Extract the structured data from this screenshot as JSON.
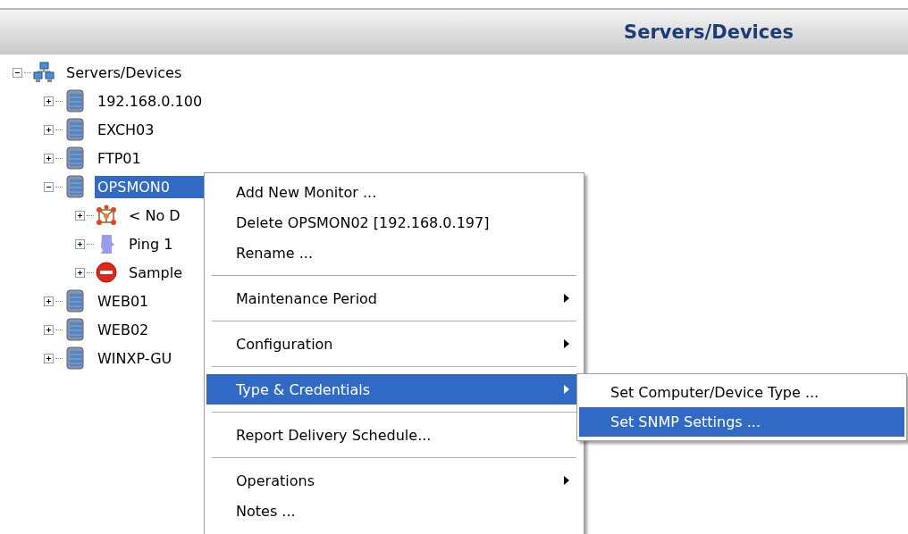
{
  "header": {
    "title": "Servers/Devices"
  },
  "tree": [
    {
      "label": "Servers/Devices",
      "kind": "network",
      "expanded": true,
      "selected": false,
      "children": [
        {
          "label": "192.168.0.100",
          "kind": "server",
          "expanded": false,
          "selected": false
        },
        {
          "label": "EXCH03",
          "kind": "server",
          "expanded": false,
          "selected": false
        },
        {
          "label": "FTP01",
          "kind": "server",
          "expanded": false,
          "selected": false
        },
        {
          "label": "OPSMON0",
          "kind": "server",
          "expanded": true,
          "selected": true,
          "children": [
            {
              "label": "< No D",
              "kind": "cluster",
              "expanded": false,
              "selected": false
            },
            {
              "label": "Ping 1",
              "kind": "probe",
              "expanded": false,
              "selected": false
            },
            {
              "label": "Sample",
              "kind": "stop",
              "expanded": false,
              "selected": false
            }
          ]
        },
        {
          "label": "WEB01",
          "kind": "server",
          "expanded": false,
          "selected": false
        },
        {
          "label": "WEB02",
          "kind": "server",
          "expanded": false,
          "selected": false
        },
        {
          "label": "WINXP-GU",
          "kind": "server",
          "expanded": false,
          "selected": false
        }
      ]
    }
  ],
  "context_menu": {
    "sections": [
      [
        {
          "label": "Add New Monitor ...",
          "submenu": false,
          "selected": false
        },
        {
          "label": "Delete OPSMON02 [192.168.0.197]",
          "submenu": false,
          "selected": false
        },
        {
          "label": "Rename ...",
          "submenu": false,
          "selected": false
        }
      ],
      [
        {
          "label": "Maintenance Period",
          "submenu": true,
          "selected": false
        }
      ],
      [
        {
          "label": "Configuration",
          "submenu": true,
          "selected": false
        }
      ],
      [
        {
          "label": "Type & Credentials",
          "submenu": true,
          "selected": true
        }
      ],
      [
        {
          "label": "Report Delivery Schedule...",
          "submenu": false,
          "selected": false
        }
      ],
      [
        {
          "label": "Operations",
          "submenu": true,
          "selected": false
        },
        {
          "label": "Notes ...",
          "submenu": false,
          "selected": false
        }
      ]
    ]
  },
  "submenu": {
    "items": [
      {
        "label": "Set Computer/Device Type ...",
        "selected": false
      },
      {
        "label": "Set SNMP Settings ...",
        "selected": true
      }
    ]
  }
}
